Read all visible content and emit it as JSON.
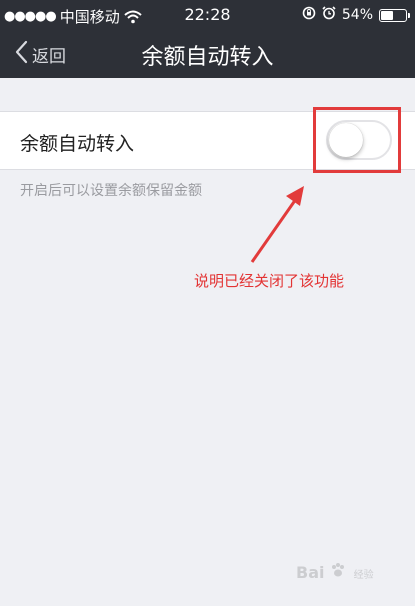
{
  "status_bar": {
    "signal": "●●●●●",
    "carrier": "中国移动",
    "time": "22:28",
    "battery_percent": "54%",
    "battery_level": 0.54
  },
  "nav": {
    "back_label": "返回",
    "title": "余额自动转入"
  },
  "setting": {
    "label": "余额自动转入",
    "enabled": false,
    "hint": "开启后可以设置余额保留金额"
  },
  "annotation": {
    "text": "说明已经关闭了该功能",
    "color": "#e33434"
  },
  "watermark": {
    "text": "Bai",
    "icon": "paw-icon",
    "suffix": "经验"
  },
  "colors": {
    "nav_bg": "#2d3037",
    "page_bg": "#eff0f4",
    "highlight": "#e23b3b"
  }
}
